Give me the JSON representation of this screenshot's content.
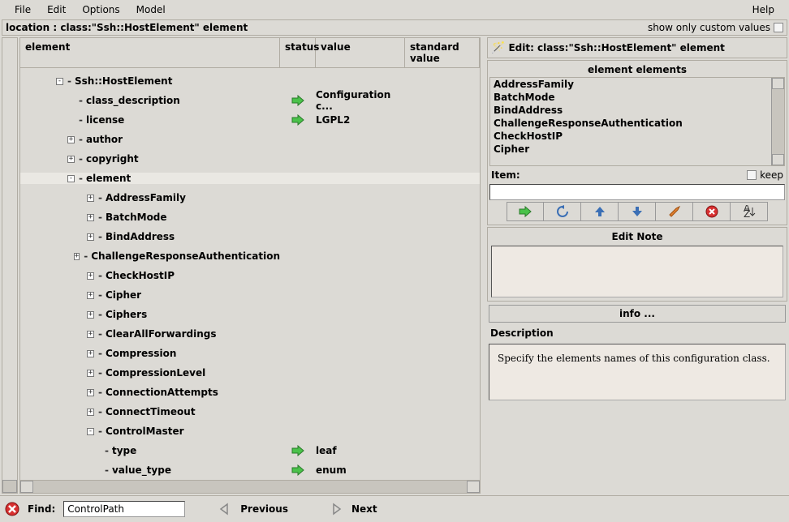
{
  "menu": {
    "file": "File",
    "edit": "Edit",
    "options": "Options",
    "model": "Model",
    "help": "Help"
  },
  "location": "location : class:\"Ssh::HostElement\" element",
  "show_custom": "show only custom values",
  "headers": {
    "element": "element",
    "status": "status",
    "value": "value",
    "standard": "standard value"
  },
  "tree": {
    "root": "Ssh::HostElement",
    "class_description": "class_description",
    "class_description_val": "Configuration c...",
    "license": "license",
    "license_val": "LGPL2",
    "author": "author",
    "copyright": "copyright",
    "element": "element",
    "items": [
      "AddressFamily",
      "BatchMode",
      "BindAddress",
      "ChallengeResponseAuthentication",
      "CheckHostIP",
      "Cipher",
      "Ciphers",
      "ClearAllForwardings",
      "Compression",
      "CompressionLevel",
      "ConnectionAttempts",
      "ConnectTimeout",
      "ControlMaster"
    ],
    "ctl_type": "type",
    "ctl_type_val": "leaf",
    "ctl_vtype": "value_type",
    "ctl_vtype_val": "enum"
  },
  "right": {
    "edit_title": "Edit: class:\"Ssh::HostElement\" element",
    "elements_title": "element elements",
    "list": [
      "AddressFamily",
      "BatchMode",
      "BindAddress",
      "ChallengeResponseAuthentication",
      "CheckHostIP",
      "Cipher"
    ],
    "item": "Item:",
    "keep": "keep",
    "edit_note": "Edit Note",
    "info": "info ...",
    "description": "Description",
    "description_text": "Specify the elements names of this configuration class."
  },
  "find": {
    "label": "Find:",
    "value": "ControlPath",
    "prev": "Previous",
    "next": "Next"
  }
}
